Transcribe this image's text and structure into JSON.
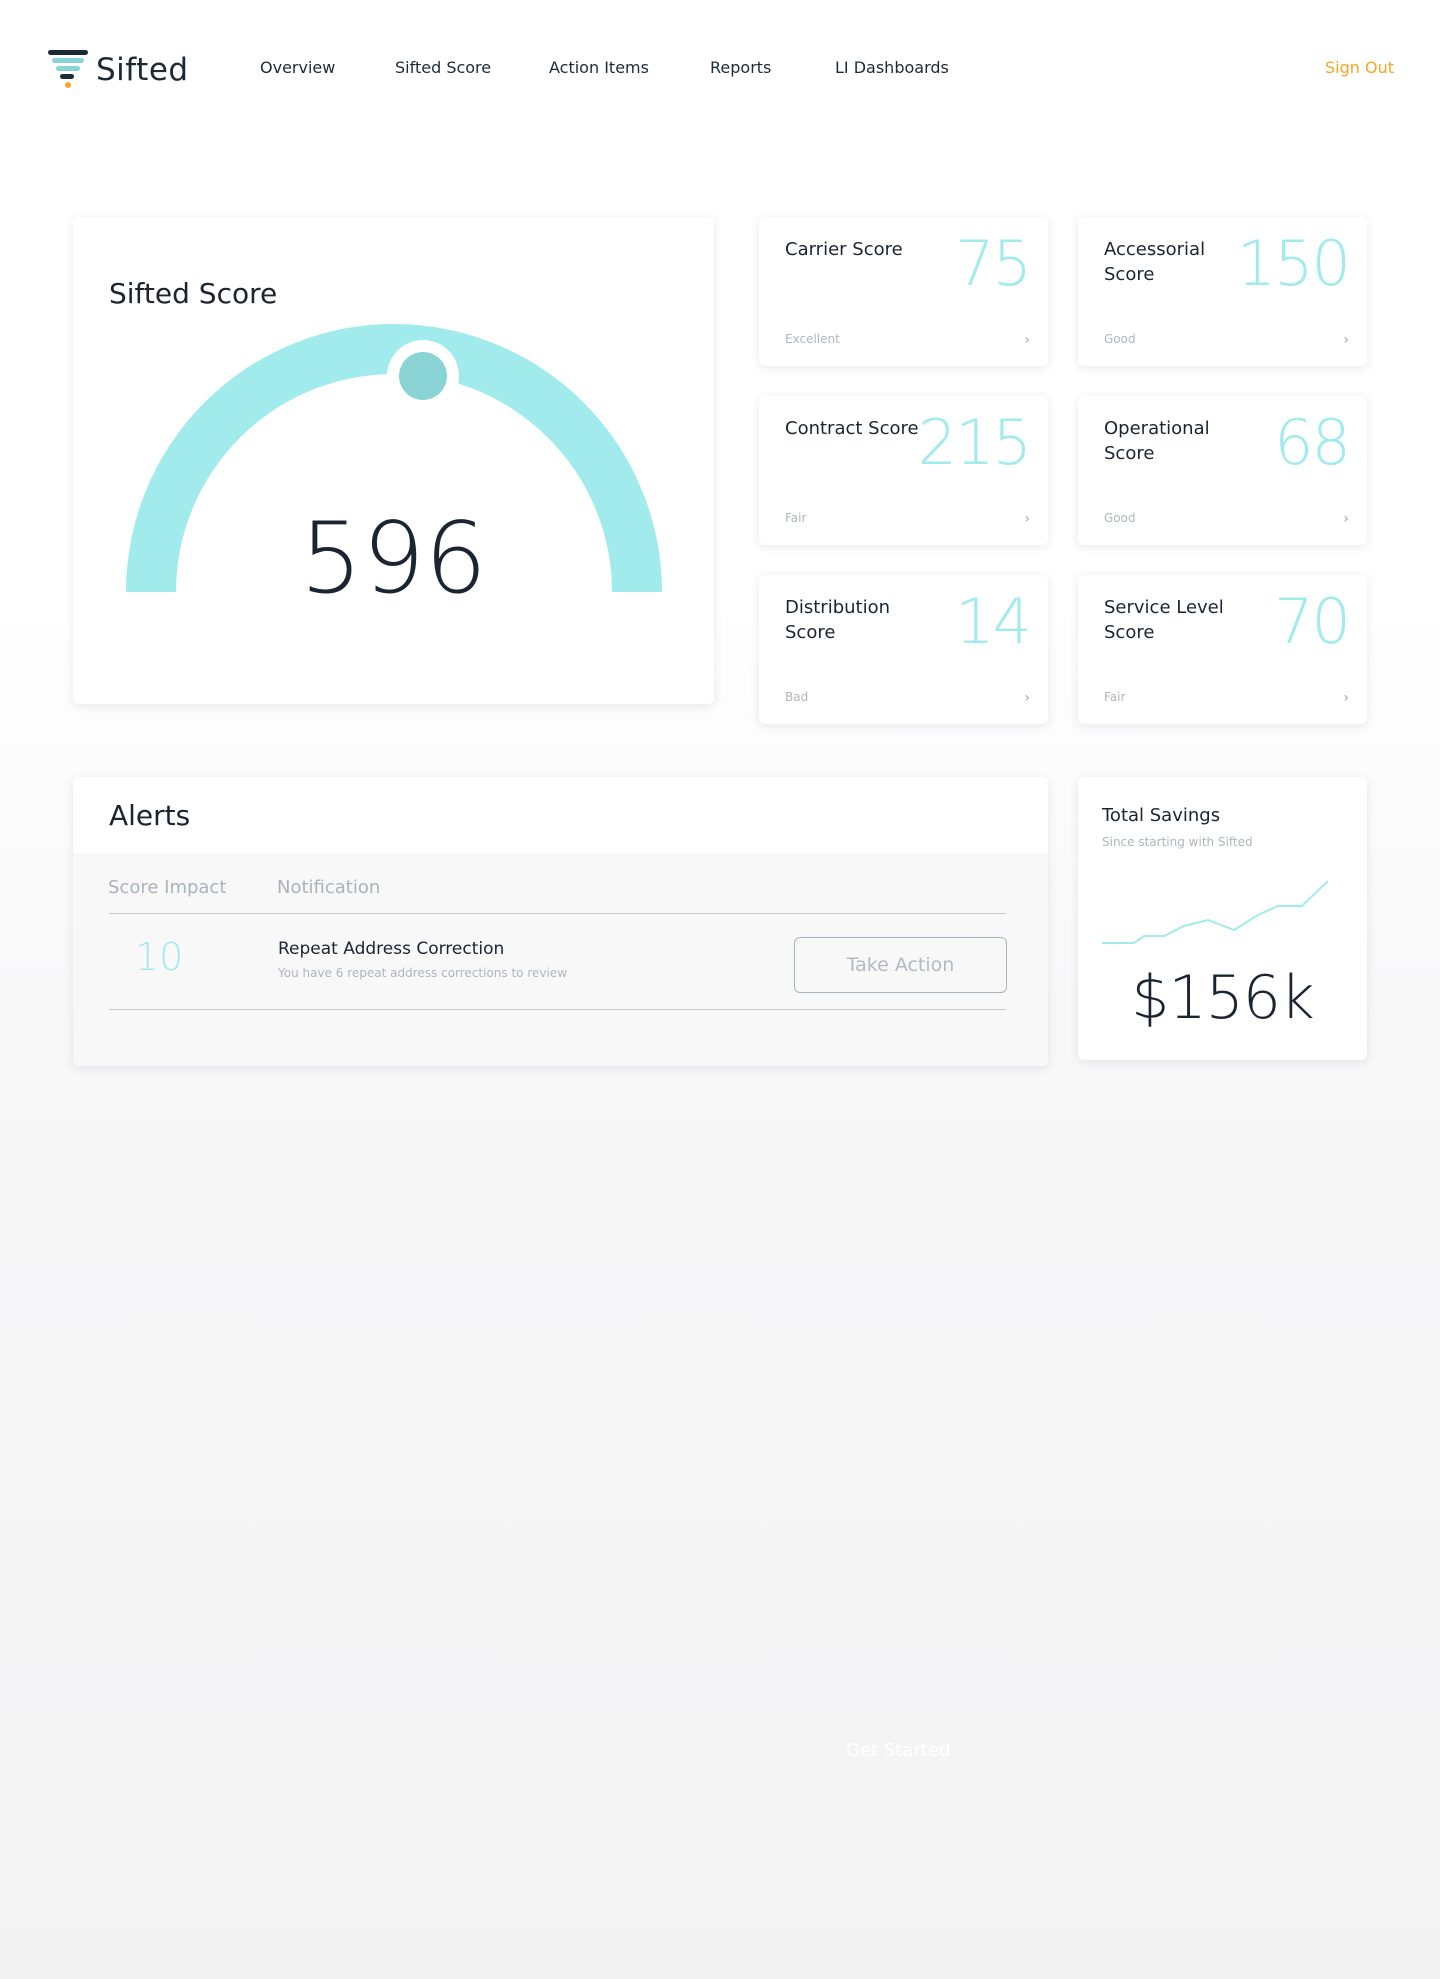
{
  "header": {
    "logo_text": "Sifted",
    "nav": [
      "Overview",
      "Sifted Score",
      "Action Items",
      "Reports",
      "LI Dashboards"
    ],
    "sign_out": "Sign Out"
  },
  "sifted_score": {
    "title": "Sifted Score",
    "value": "596"
  },
  "score_cards": [
    {
      "label": "Carrier Score",
      "value": "75",
      "status": "Excellent"
    },
    {
      "label": "Accessorial Score",
      "value": "150",
      "status": "Good"
    },
    {
      "label": "Contract Score",
      "value": "215",
      "status": "Fair"
    },
    {
      "label": "Operational Score",
      "value": "68",
      "status": "Good"
    },
    {
      "label": "Distribution Score",
      "value": "14",
      "status": "Bad"
    },
    {
      "label": "Service Level Score",
      "value": "70",
      "status": "Fair"
    }
  ],
  "alerts": {
    "title": "Alerts",
    "columns": [
      "Score Impact",
      "Notification"
    ],
    "rows": [
      {
        "impact": "10",
        "title": "Repeat Address Correction",
        "subtitle": "You have 6 repeat address corrections to review",
        "action": "Take Action"
      }
    ]
  },
  "savings": {
    "title": "Total Savings",
    "subtitle": "Since starting with Sifted",
    "value": "$156k"
  },
  "footer": {
    "cta": "Get Started"
  },
  "colors": {
    "accent": "#a1ebec",
    "accent_dark": "#7fcfd2",
    "warning": "#f5a623",
    "text": "#1b2430"
  }
}
